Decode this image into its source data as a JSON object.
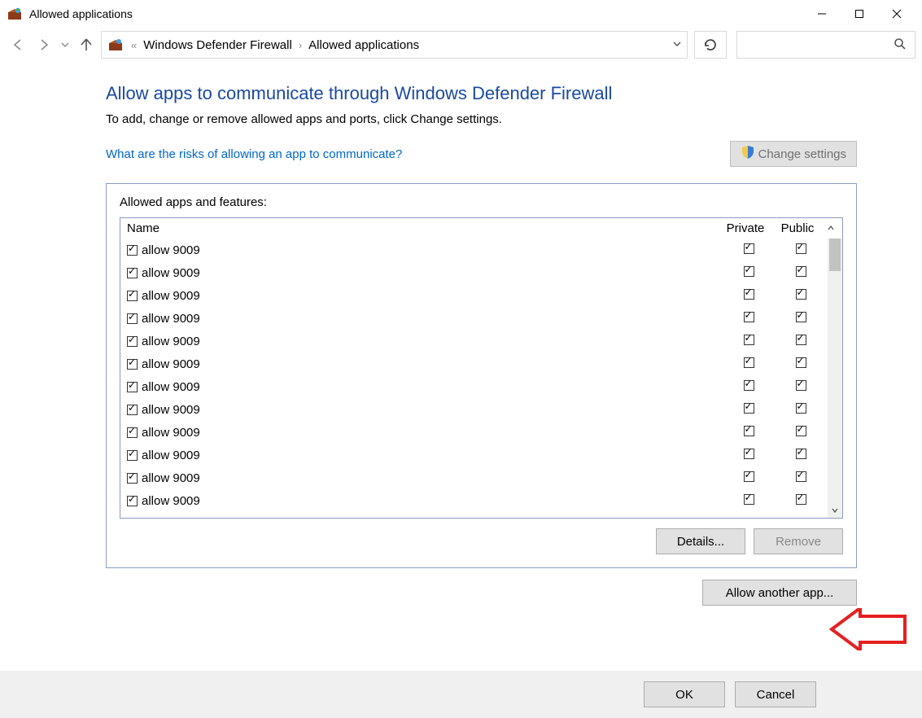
{
  "window": {
    "title": "Allowed applications"
  },
  "breadcrumb": {
    "item1": "Windows Defender Firewall",
    "item2": "Allowed applications"
  },
  "page": {
    "heading": "Allow apps to communicate through Windows Defender Firewall",
    "subtext": "To add, change or remove allowed apps and ports, click Change settings.",
    "risk_link": "What are the risks of allowing an app to communicate?",
    "change_settings": "Change settings",
    "panel_label": "Allowed apps and features:",
    "col_name": "Name",
    "col_private": "Private",
    "col_public": "Public",
    "details_btn": "Details...",
    "remove_btn": "Remove",
    "allow_another_btn": "Allow another app...",
    "ok_btn": "OK",
    "cancel_btn": "Cancel"
  },
  "rows": [
    {
      "name": "allow 9009",
      "enabled": true,
      "private": true,
      "public": true
    },
    {
      "name": "allow 9009",
      "enabled": true,
      "private": true,
      "public": true
    },
    {
      "name": "allow 9009",
      "enabled": true,
      "private": true,
      "public": true
    },
    {
      "name": "allow 9009",
      "enabled": true,
      "private": true,
      "public": true
    },
    {
      "name": "allow 9009",
      "enabled": true,
      "private": true,
      "public": true
    },
    {
      "name": "allow 9009",
      "enabled": true,
      "private": true,
      "public": true
    },
    {
      "name": "allow 9009",
      "enabled": true,
      "private": true,
      "public": true
    },
    {
      "name": "allow 9009",
      "enabled": true,
      "private": true,
      "public": true
    },
    {
      "name": "allow 9009",
      "enabled": true,
      "private": true,
      "public": true
    },
    {
      "name": "allow 9009",
      "enabled": true,
      "private": true,
      "public": true
    },
    {
      "name": "allow 9009",
      "enabled": true,
      "private": true,
      "public": true
    },
    {
      "name": "allow 9009",
      "enabled": true,
      "private": true,
      "public": true
    }
  ]
}
